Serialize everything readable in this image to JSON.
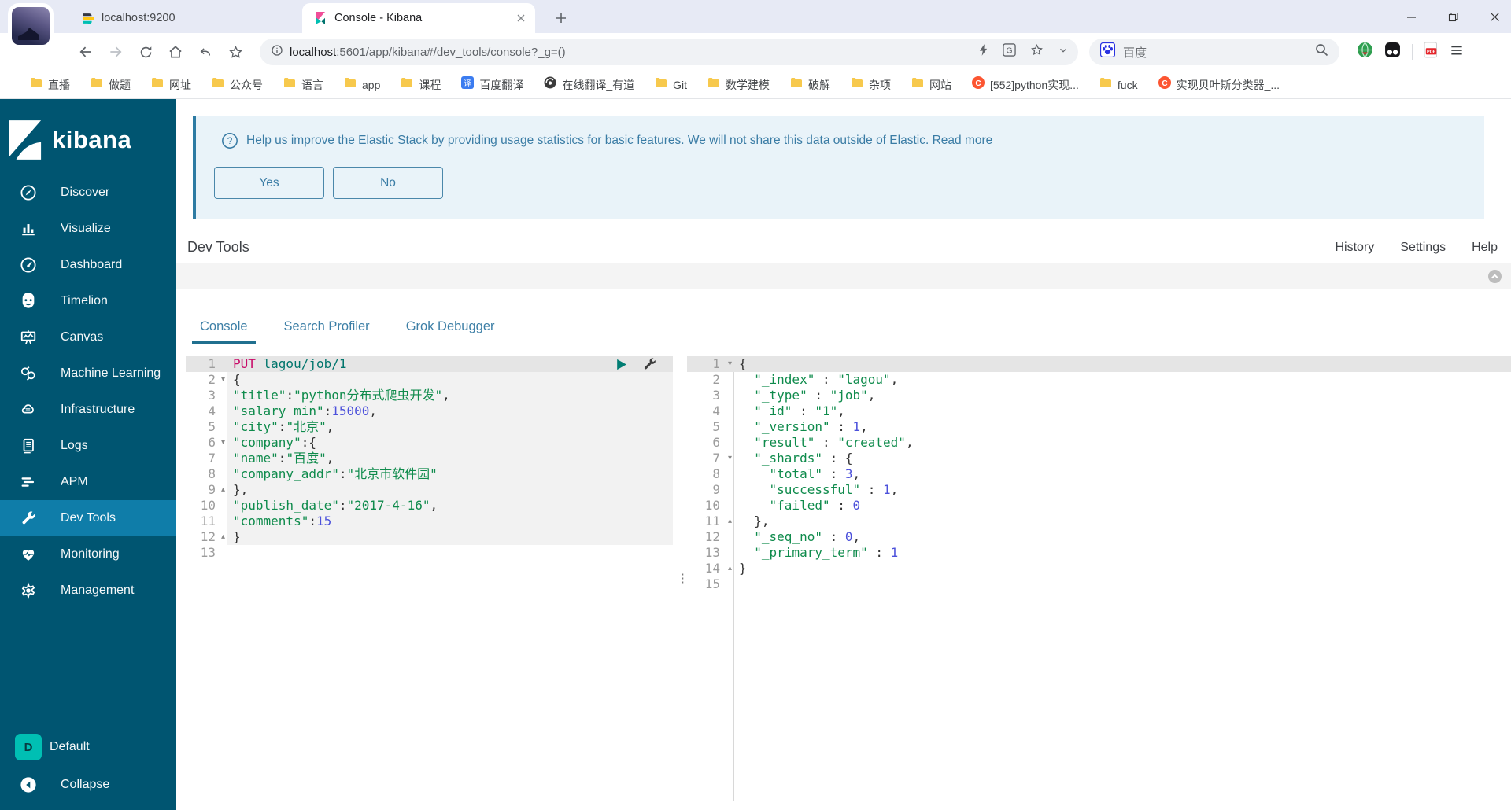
{
  "browser": {
    "tabs": [
      {
        "title": "localhost:9200",
        "icon": "elasticsearch",
        "active": false
      },
      {
        "title": "Console - Kibana",
        "icon": "kibana",
        "active": true
      }
    ],
    "address": {
      "domain": "localhost",
      "path": ":5601/app/kibana#/dev_tools/console?_g=()"
    },
    "search": {
      "engine_label": "百度"
    },
    "bookmarks": [
      {
        "label": "直播",
        "icon": "folder"
      },
      {
        "label": "做题",
        "icon": "folder"
      },
      {
        "label": "网址",
        "icon": "folder"
      },
      {
        "label": "公众号",
        "icon": "folder"
      },
      {
        "label": "语言",
        "icon": "folder"
      },
      {
        "label": "app",
        "icon": "folder"
      },
      {
        "label": "课程",
        "icon": "folder"
      },
      {
        "label": "百度翻译",
        "icon": "translate-bm"
      },
      {
        "label": "在线翻译_有道",
        "icon": "youdao"
      },
      {
        "label": "Git",
        "icon": "folder"
      },
      {
        "label": "数学建模",
        "icon": "folder"
      },
      {
        "label": "破解",
        "icon": "folder"
      },
      {
        "label": "杂项",
        "icon": "folder"
      },
      {
        "label": "网站",
        "icon": "folder"
      },
      {
        "label": "[552]python实现...",
        "icon": "csdn"
      },
      {
        "label": "fuck",
        "icon": "folder"
      },
      {
        "label": "实现贝叶斯分类器_...",
        "icon": "csdn"
      }
    ]
  },
  "sidebar": {
    "logo_text": "kibana",
    "items": [
      {
        "label": "Discover",
        "icon": "discover"
      },
      {
        "label": "Visualize",
        "icon": "visualize"
      },
      {
        "label": "Dashboard",
        "icon": "dashboard"
      },
      {
        "label": "Timelion",
        "icon": "timelion"
      },
      {
        "label": "Canvas",
        "icon": "canvas"
      },
      {
        "label": "Machine Learning",
        "icon": "ml"
      },
      {
        "label": "Infrastructure",
        "icon": "infrastructure"
      },
      {
        "label": "Logs",
        "icon": "logs"
      },
      {
        "label": "APM",
        "icon": "apm"
      },
      {
        "label": "Dev Tools",
        "icon": "devtools",
        "active": true
      },
      {
        "label": "Monitoring",
        "icon": "monitoring"
      },
      {
        "label": "Management",
        "icon": "management"
      }
    ],
    "footer": [
      {
        "label": "Default",
        "badge": "D"
      },
      {
        "label": "Collapse"
      }
    ]
  },
  "banner": {
    "message": "Help us improve the Elastic Stack by providing usage statistics for basic features. We will not share this data outside of Elastic.",
    "link_label": "Read more",
    "yes_label": "Yes",
    "no_label": "No"
  },
  "devtools": {
    "title": "Dev Tools",
    "menu": [
      {
        "label": "History"
      },
      {
        "label": "Settings"
      },
      {
        "label": "Help"
      }
    ],
    "tabs": [
      {
        "label": "Console",
        "active": true
      },
      {
        "label": "Search Profiler",
        "active": false
      },
      {
        "label": "Grok Debugger",
        "active": false
      }
    ]
  },
  "console": {
    "request": {
      "lines": [
        {
          "n": "1",
          "hl": true,
          "req": true,
          "fold": "",
          "seg": [
            {
              "t": "PUT ",
              "c": "m"
            },
            {
              "t": "lagou/job/1",
              "c": "u"
            }
          ]
        },
        {
          "n": "2",
          "req": true,
          "fold": "open",
          "seg": [
            {
              "t": "{",
              "c": "p"
            }
          ]
        },
        {
          "n": "3",
          "req": true,
          "fold": "",
          "seg": [
            {
              "t": "\"title\"",
              "c": "g"
            },
            {
              "t": ":",
              "c": "p"
            },
            {
              "t": "\"python分布式爬虫开发\"",
              "c": "g"
            },
            {
              "t": ",",
              "c": "p"
            }
          ]
        },
        {
          "n": "4",
          "req": true,
          "fold": "",
          "seg": [
            {
              "t": "\"salary_min\"",
              "c": "g"
            },
            {
              "t": ":",
              "c": "p"
            },
            {
              "t": "15000",
              "c": "n"
            },
            {
              "t": ",",
              "c": "p"
            }
          ]
        },
        {
          "n": "5",
          "req": true,
          "fold": "",
          "seg": [
            {
              "t": "\"city\"",
              "c": "g"
            },
            {
              "t": ":",
              "c": "p"
            },
            {
              "t": "\"北京\"",
              "c": "g"
            },
            {
              "t": ",",
              "c": "p"
            }
          ]
        },
        {
          "n": "6",
          "req": true,
          "fold": "open",
          "seg": [
            {
              "t": "\"company\"",
              "c": "g"
            },
            {
              "t": ":",
              "c": "p"
            },
            {
              "t": "{",
              "c": "p"
            }
          ]
        },
        {
          "n": "7",
          "req": true,
          "fold": "",
          "seg": [
            {
              "t": "\"name\"",
              "c": "g"
            },
            {
              "t": ":",
              "c": "p"
            },
            {
              "t": "\"百度\"",
              "c": "g"
            },
            {
              "t": ",",
              "c": "p"
            }
          ]
        },
        {
          "n": "8",
          "req": true,
          "fold": "",
          "seg": [
            {
              "t": "\"company_addr\"",
              "c": "g"
            },
            {
              "t": ":",
              "c": "p"
            },
            {
              "t": "\"北京市软件园\"",
              "c": "g"
            }
          ]
        },
        {
          "n": "9",
          "req": true,
          "fold": "close",
          "seg": [
            {
              "t": "},",
              "c": "p"
            }
          ]
        },
        {
          "n": "10",
          "req": true,
          "fold": "",
          "seg": [
            {
              "t": "\"publish_date\"",
              "c": "g"
            },
            {
              "t": ":",
              "c": "p"
            },
            {
              "t": "\"2017-4-16\"",
              "c": "g"
            },
            {
              "t": ",",
              "c": "p"
            }
          ]
        },
        {
          "n": "11",
          "req": true,
          "fold": "",
          "seg": [
            {
              "t": "\"comments\"",
              "c": "g"
            },
            {
              "t": ":",
              "c": "p"
            },
            {
              "t": "15",
              "c": "n"
            }
          ]
        },
        {
          "n": "12",
          "req": true,
          "fold": "close",
          "seg": [
            {
              "t": "}",
              "c": "p"
            }
          ]
        },
        {
          "n": "13",
          "fold": "",
          "seg": []
        }
      ]
    },
    "response": {
      "lines": [
        {
          "n": "1",
          "hl": true,
          "fold": "open",
          "seg": [
            {
              "t": "{",
              "c": "p"
            }
          ]
        },
        {
          "n": "2",
          "fold": "",
          "seg": [
            {
              "t": "  ",
              "c": "p"
            },
            {
              "t": "\"_index\"",
              "c": "g"
            },
            {
              "t": " : ",
              "c": "p"
            },
            {
              "t": "\"lagou\"",
              "c": "g"
            },
            {
              "t": ",",
              "c": "p"
            }
          ]
        },
        {
          "n": "3",
          "fold": "",
          "seg": [
            {
              "t": "  ",
              "c": "p"
            },
            {
              "t": "\"_type\"",
              "c": "g"
            },
            {
              "t": " : ",
              "c": "p"
            },
            {
              "t": "\"job\"",
              "c": "g"
            },
            {
              "t": ",",
              "c": "p"
            }
          ]
        },
        {
          "n": "4",
          "fold": "",
          "seg": [
            {
              "t": "  ",
              "c": "p"
            },
            {
              "t": "\"_id\"",
              "c": "g"
            },
            {
              "t": " : ",
              "c": "p"
            },
            {
              "t": "\"1\"",
              "c": "g"
            },
            {
              "t": ",",
              "c": "p"
            }
          ]
        },
        {
          "n": "5",
          "fold": "",
          "seg": [
            {
              "t": "  ",
              "c": "p"
            },
            {
              "t": "\"_version\"",
              "c": "g"
            },
            {
              "t": " : ",
              "c": "p"
            },
            {
              "t": "1",
              "c": "n"
            },
            {
              "t": ",",
              "c": "p"
            }
          ]
        },
        {
          "n": "6",
          "fold": "",
          "seg": [
            {
              "t": "  ",
              "c": "p"
            },
            {
              "t": "\"result\"",
              "c": "g"
            },
            {
              "t": " : ",
              "c": "p"
            },
            {
              "t": "\"created\"",
              "c": "g"
            },
            {
              "t": ",",
              "c": "p"
            }
          ]
        },
        {
          "n": "7",
          "fold": "open",
          "seg": [
            {
              "t": "  ",
              "c": "p"
            },
            {
              "t": "\"_shards\"",
              "c": "g"
            },
            {
              "t": " : ",
              "c": "p"
            },
            {
              "t": "{",
              "c": "p"
            }
          ]
        },
        {
          "n": "8",
          "fold": "",
          "seg": [
            {
              "t": "    ",
              "c": "p"
            },
            {
              "t": "\"total\"",
              "c": "g"
            },
            {
              "t": " : ",
              "c": "p"
            },
            {
              "t": "3",
              "c": "n"
            },
            {
              "t": ",",
              "c": "p"
            }
          ]
        },
        {
          "n": "9",
          "fold": "",
          "seg": [
            {
              "t": "    ",
              "c": "p"
            },
            {
              "t": "\"successful\"",
              "c": "g"
            },
            {
              "t": " : ",
              "c": "p"
            },
            {
              "t": "1",
              "c": "n"
            },
            {
              "t": ",",
              "c": "p"
            }
          ]
        },
        {
          "n": "10",
          "fold": "",
          "seg": [
            {
              "t": "    ",
              "c": "p"
            },
            {
              "t": "\"failed\"",
              "c": "g"
            },
            {
              "t": " : ",
              "c": "p"
            },
            {
              "t": "0",
              "c": "n"
            }
          ]
        },
        {
          "n": "11",
          "fold": "close",
          "seg": [
            {
              "t": "  },",
              "c": "p"
            }
          ]
        },
        {
          "n": "12",
          "fold": "",
          "seg": [
            {
              "t": "  ",
              "c": "p"
            },
            {
              "t": "\"_seq_no\"",
              "c": "g"
            },
            {
              "t": " : ",
              "c": "p"
            },
            {
              "t": "0",
              "c": "n"
            },
            {
              "t": ",",
              "c": "p"
            }
          ]
        },
        {
          "n": "13",
          "fold": "",
          "seg": [
            {
              "t": "  ",
              "c": "p"
            },
            {
              "t": "\"_primary_term\"",
              "c": "g"
            },
            {
              "t": " : ",
              "c": "p"
            },
            {
              "t": "1",
              "c": "n"
            }
          ]
        },
        {
          "n": "14",
          "fold": "close",
          "seg": [
            {
              "t": "}",
              "c": "p"
            }
          ]
        },
        {
          "n": "15",
          "fold": "",
          "seg": []
        }
      ]
    }
  },
  "colors": {
    "sidebar_bg": "#005571",
    "sidebar_active": "#0f7da9",
    "banner_bg": "#e9f3f9",
    "accent_teal": "#3a7ca5",
    "method_pink": "#c80a68",
    "string_green": "#0f8b4c",
    "number_violet": "#4c51db"
  }
}
